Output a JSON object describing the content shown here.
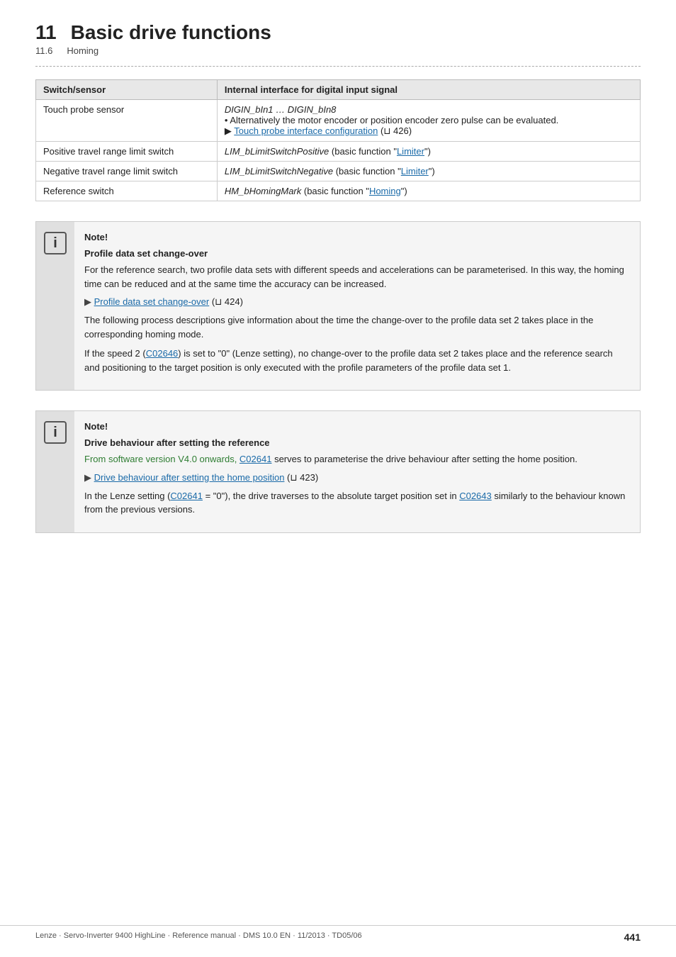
{
  "header": {
    "chapter_num": "11",
    "chapter_name": "Basic drive functions",
    "sub_num": "11.6",
    "sub_name": "Homing"
  },
  "table": {
    "col1_header": "Switch/sensor",
    "col2_header": "Internal interface for digital input signal",
    "rows": [
      {
        "col1": "Touch probe sensor",
        "col2_main": "DIGIN_bIn1 … DIGIN_bIn8",
        "col2_bullets": [
          "Alternatively the motor encoder or position encoder zero pulse can be evaluated.",
          "Touch probe interface configuration (⊔ 426)"
        ],
        "col2_link_text": "Touch probe interface configuration",
        "col2_link_ref": "426"
      },
      {
        "col1": "Positive travel range limit switch",
        "col2_italic": "LIM_bLimitSwitchPositive",
        "col2_text": " (basic function \"",
        "col2_link": "Limiter",
        "col2_end": "\")"
      },
      {
        "col1": "Negative travel range limit switch",
        "col2_italic": "LIM_bLimitSwitchNegative",
        "col2_text": " (basic function \"",
        "col2_link": "Limiter",
        "col2_end": "\")"
      },
      {
        "col1": "Reference switch",
        "col2_italic": "HM_bHomingMark",
        "col2_text": " (basic function \"",
        "col2_link": "Homing",
        "col2_end": "\")"
      }
    ]
  },
  "note1": {
    "title": "Note!",
    "subtitle": "Profile data set change-over",
    "para1": "For the reference search, two profile data sets with different speeds and accelerations can be parameterised. In this way, the homing time can be reduced and at the same time the accuracy can be increased.",
    "link_label": "Profile data set change-over",
    "link_ref": "424",
    "para2": "The following process descriptions give information about the time the change-over to the profile data set 2 takes place in the corresponding homing mode.",
    "para3_start": "If the speed 2 (",
    "para3_link": "C02646",
    "para3_end": ") is set to \"0\" (Lenze setting), no change-over to the profile data set 2 takes place and the reference search and positioning to the target position is only executed with the profile parameters of the profile data set 1."
  },
  "note2": {
    "title": "Note!",
    "subtitle": "Drive behaviour after setting the reference",
    "para1_green": "From software version V4.0 onwards, ",
    "para1_link": "C02641",
    "para1_end": " serves to parameterise the drive behaviour after setting the home position.",
    "link_label": "Drive behaviour after setting the home position",
    "link_ref": "423",
    "para2_start": "In the Lenze setting (",
    "para2_link1": "C02641",
    "para2_mid": " = \"0\"), the drive traverses to the absolute target position set in ",
    "para2_link2": "C02643",
    "para2_end": " similarly to the behaviour known from the previous versions."
  },
  "footer": {
    "left": "Lenze · Servo-Inverter 9400 HighLine · Reference manual · DMS 10.0 EN · 11/2013 · TD05/06",
    "right": "441"
  }
}
